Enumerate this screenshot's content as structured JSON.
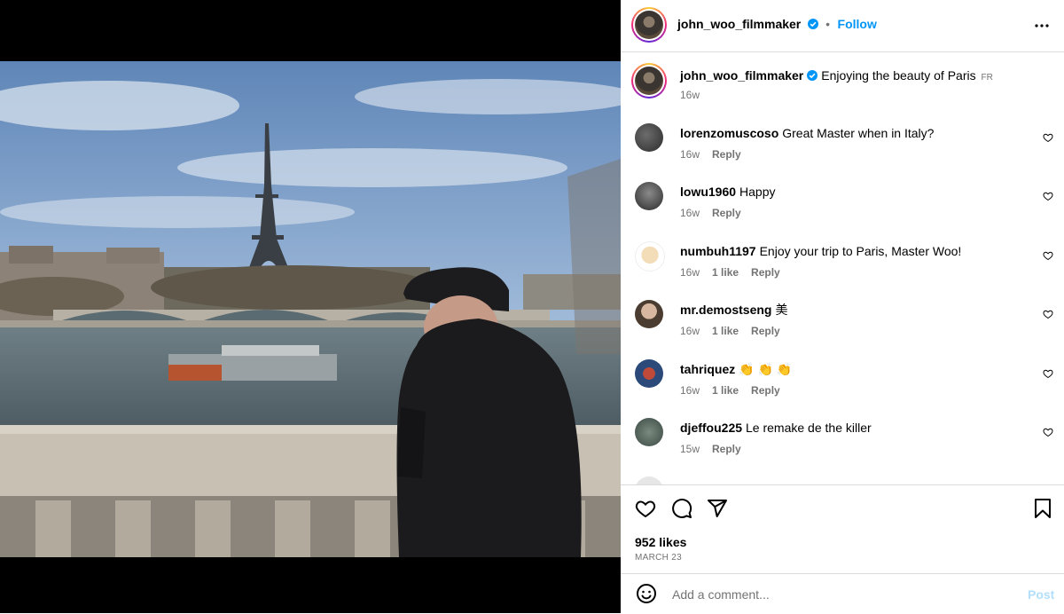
{
  "post": {
    "username": "john_woo_filmmaker",
    "separator": "•",
    "follow_label": "Follow",
    "caption": "Enjoying the beauty of Paris",
    "caption_lang": "FR",
    "caption_time": "16w",
    "likes": "952 likes",
    "date": "MARCH 23"
  },
  "comments": [
    {
      "user": "lorenzomuscoso",
      "text": "Great Master when in Italy?",
      "time": "16w",
      "likes": "",
      "reply": "Reply"
    },
    {
      "user": "lowu1960",
      "text": "Happy",
      "time": "16w",
      "likes": "",
      "reply": "Reply"
    },
    {
      "user": "numbuh1197",
      "text": "Enjoy your trip to Paris, Master Woo!",
      "time": "16w",
      "likes": "1 like",
      "reply": "Reply"
    },
    {
      "user": "mr.demostseng",
      "text": "美",
      "time": "16w",
      "likes": "1 like",
      "reply": "Reply"
    },
    {
      "user": "tahriquez",
      "text": "👏 👏 👏",
      "time": "16w",
      "likes": "1 like",
      "reply": "Reply"
    },
    {
      "user": "djeffou225",
      "text": "Le remake de the killer",
      "time": "15w",
      "likes": "",
      "reply": "Reply"
    }
  ],
  "composer": {
    "placeholder": "Add a comment...",
    "post_label": "Post"
  },
  "colors": {
    "accent": "#0095f6",
    "verified": "#0095f6",
    "muted": "#737373",
    "divider": "#dbdbdb"
  },
  "icons": [
    "verified-badge-icon",
    "more-options-icon",
    "heart-icon",
    "comment-icon",
    "share-icon",
    "bookmark-icon",
    "emoji-icon"
  ]
}
